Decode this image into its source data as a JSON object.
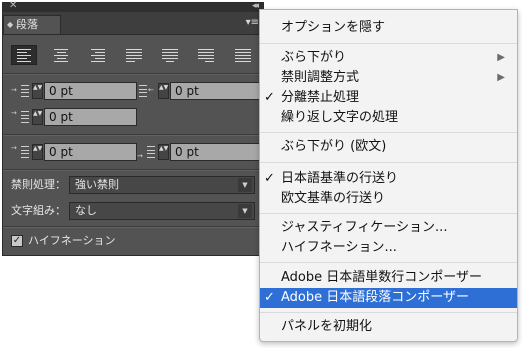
{
  "panel": {
    "close_glyph": "✕",
    "collapse_glyph": "◂◂",
    "tab_arrows": "◆",
    "tab_label": "段落",
    "menu_glyph": "▾≡",
    "align_buttons": [
      "align-left",
      "align-center",
      "align-right",
      "justify-left",
      "justify-center",
      "justify-right",
      "justify-all"
    ],
    "left_indent": "0 pt",
    "right_indent": "0 pt",
    "first_line_indent": "0 pt",
    "space_before": "0 pt",
    "space_after": "0 pt",
    "kinsoku_label": "禁則処理：",
    "kinsoku_value": "強い禁則",
    "mojikumi_label": "文字組み：",
    "mojikumi_value": "なし",
    "hyphenation_checked": true,
    "hyphenation_label": "ハイフネーション",
    "checkmark": "✓",
    "dropdown_arrow": "▼",
    "spin_glyph": "▲▼"
  },
  "menu": {
    "submenu_arrow": "▶",
    "check_glyph": "✓",
    "items": [
      {
        "label": "オプションを隠す",
        "checked": false,
        "submenu": false
      },
      {
        "label": "ぶら下がり",
        "checked": false,
        "submenu": true
      },
      {
        "label": "禁則調整方式",
        "checked": false,
        "submenu": true
      },
      {
        "label": "分離禁止処理",
        "checked": true,
        "submenu": false
      },
      {
        "label": "繰り返し文字の処理",
        "checked": false,
        "submenu": false
      },
      {
        "label": "ぶら下がり (欧文)",
        "checked": false,
        "submenu": false
      },
      {
        "label": "日本語基準の行送り",
        "checked": true,
        "submenu": false
      },
      {
        "label": "欧文基準の行送り",
        "checked": false,
        "submenu": false
      },
      {
        "label": "ジャスティフィケーション...",
        "checked": false,
        "submenu": false
      },
      {
        "label": "ハイフネーション...",
        "checked": false,
        "submenu": false
      },
      {
        "label": "Adobe 日本語単数行コンポーザー",
        "checked": false,
        "submenu": false
      },
      {
        "label": "Adobe 日本語段落コンポーザー",
        "checked": true,
        "submenu": false,
        "selected": true
      },
      {
        "label": "パネルを初期化",
        "checked": false,
        "submenu": false
      }
    ]
  }
}
